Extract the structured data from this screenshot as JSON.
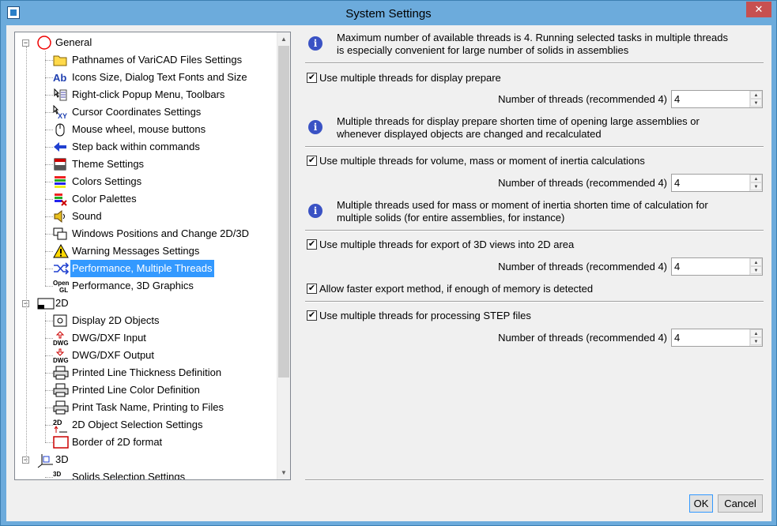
{
  "window": {
    "title": "System Settings",
    "close_label": "✕"
  },
  "tree": {
    "general": "General",
    "items_general": [
      "Pathnames of VariCAD Files Settings",
      "Icons Size, Dialog Text Fonts and Size",
      "Right-click Popup Menu, Toolbars",
      "Cursor Coordinates Settings",
      "Mouse wheel, mouse buttons",
      "Step back within commands",
      "Theme Settings",
      "Colors Settings",
      "Color Palettes",
      "Sound",
      "Windows Positions and Change 2D/3D",
      "Warning Messages Settings",
      "Performance, Multiple Threads",
      "Performance, 3D Graphics"
    ],
    "section_2d": "2D",
    "items_2d": [
      "Display 2D Objects",
      "DWG/DXF Input",
      "DWG/DXF Output",
      "Printed Line Thickness Definition",
      "Printed Line Color Definition",
      "Print Task Name, Printing to Files",
      "2D Object Selection Settings",
      "Border of 2D format"
    ],
    "section_3d": "3D",
    "items_3d": [
      "Solids Selection Settings"
    ],
    "icon_ab": "Ab",
    "icon_xy": "XY",
    "icon_opengl": "Open GL",
    "icon_dwg": "DWG",
    "icon_2d": "2D"
  },
  "settings": {
    "info1": "Maximum number of available threads is 4. Running selected tasks in multiple threads is especially convenient for large number of solids in assemblies",
    "check1": "Use multiple threads for display prepare",
    "threads_label": "Number of threads (recommended 4)",
    "threads1": "4",
    "info2": "Multiple threads for display prepare shorten time of opening large assemblies or whenever displayed objects are changed and recalculated",
    "check2": "Use multiple threads for volume, mass or moment of inertia calculations",
    "threads2": "4",
    "info3": "Multiple threads used for mass or moment of inertia shorten time of calculation for multiple solids (for entire assemblies, for instance)",
    "check3": "Use multiple threads for export of 3D views into 2D area",
    "threads3": "4",
    "check4": "Allow faster export method, if enough of memory is detected",
    "check5": "Use multiple threads for processing STEP files",
    "threads5": "4",
    "checkmark": "✔"
  },
  "buttons": {
    "ok": "OK",
    "cancel": "Cancel"
  }
}
